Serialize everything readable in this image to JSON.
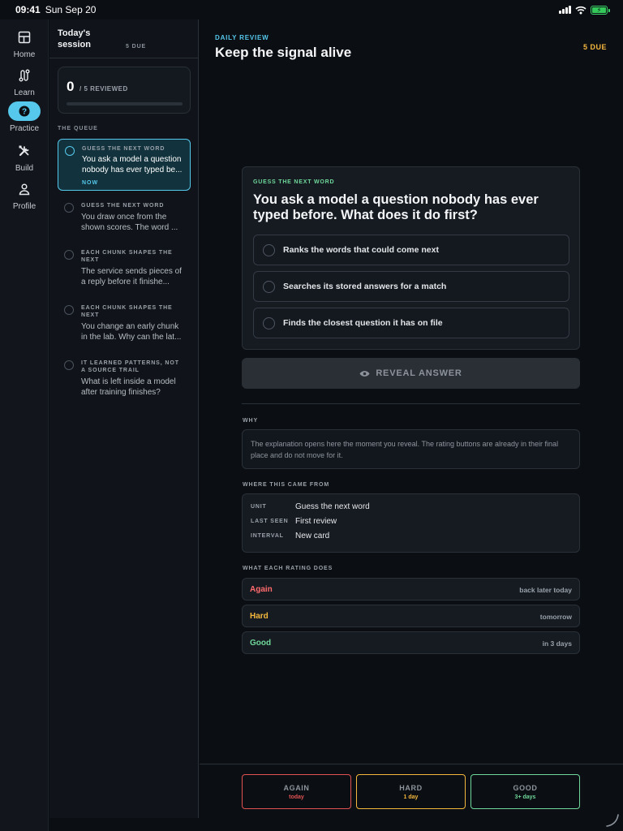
{
  "status_bar": {
    "time": "09:41",
    "date": "Sun Sep 20"
  },
  "nav": [
    {
      "label": "Home",
      "icon": "home-icon",
      "active": false
    },
    {
      "label": "Learn",
      "icon": "learn-path-icon",
      "active": false
    },
    {
      "label": "Practice",
      "icon": "question-icon",
      "active": true
    },
    {
      "label": "Build",
      "icon": "tools-icon",
      "active": false
    },
    {
      "label": "Profile",
      "icon": "person-icon",
      "active": false
    }
  ],
  "session": {
    "title": "Today's session",
    "due": "5 DUE",
    "reviewed_count": "0",
    "reviewed_caption": "/ 5 REVIEWED",
    "progress_fraction": 0,
    "queue_label": "THE QUEUE",
    "queue": [
      {
        "category": "GUESS THE NEXT WORD",
        "text": "You ask a model a question nobody has ever typed be...",
        "badge": "NOW"
      },
      {
        "category": "GUESS THE NEXT WORD",
        "text": "You draw once from the shown scores. The word ..."
      },
      {
        "category": "EACH CHUNK SHAPES THE NEXT",
        "text": "The service sends pieces of a reply before it finishe..."
      },
      {
        "category": "EACH CHUNK SHAPES THE NEXT",
        "text": "You change an early chunk in the lab. Why can the lat..."
      },
      {
        "category": "IT LEARNED PATTERNS, NOT A SOURCE TRAIL",
        "text": "What is left inside a model after training finishes?"
      }
    ]
  },
  "header": {
    "eyebrow": "DAILY REVIEW",
    "title": "Keep the signal alive",
    "due": "5 DUE"
  },
  "question": {
    "category": "GUESS THE NEXT WORD",
    "text": "You ask a model a question nobody has ever typed before. What does it do first?",
    "options": [
      "Ranks the words that could come next",
      "Searches its stored answers for a match",
      "Finds the closest question it has on file"
    ],
    "reveal_label": "REVEAL ANSWER"
  },
  "why": {
    "label": "WHY",
    "text": "The explanation opens here the moment you reveal. The rating buttons are already in their final place and do not move for it."
  },
  "source": {
    "label": "WHERE THIS CAME FROM",
    "rows": [
      {
        "key": "UNIT",
        "value": "Guess the next word"
      },
      {
        "key": "LAST SEEN",
        "value": "First review"
      },
      {
        "key": "INTERVAL",
        "value": "New card"
      }
    ]
  },
  "ratings": {
    "label": "WHAT EACH RATING DOES",
    "rows": [
      {
        "name": "Again",
        "when": "back later today",
        "color": "#ff6b6b"
      },
      {
        "name": "Hard",
        "when": "tomorrow",
        "color": "#f5b83d"
      },
      {
        "name": "Good",
        "when": "in 3 days",
        "color": "#6fd89a"
      }
    ]
  },
  "buttons": [
    {
      "name": "AGAIN",
      "sub": "today",
      "color": "#e05252"
    },
    {
      "name": "HARD",
      "sub": "1 day",
      "color": "#f5b83d"
    },
    {
      "name": "GOOD",
      "sub": "3+ days",
      "color": "#6fd89a"
    }
  ],
  "colors": {
    "accent": "#56c8ec",
    "background": "#0b0e13"
  }
}
